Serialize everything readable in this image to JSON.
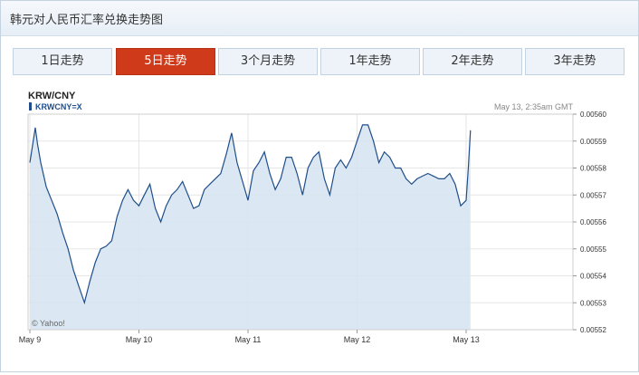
{
  "window": {
    "title": "韩元对人民币汇率兑换走势图"
  },
  "tabs": [
    {
      "label": "1日走势",
      "active": false
    },
    {
      "label": "5日走势",
      "active": true
    },
    {
      "label": "3个月走势",
      "active": false
    },
    {
      "label": "1年走势",
      "active": false
    },
    {
      "label": "2年走势",
      "active": false
    },
    {
      "label": "3年走势",
      "active": false
    }
  ],
  "colors": {
    "accent": "#cf3a1b",
    "series_line": "#1f4e8a",
    "area_fill": "#d5e4f1"
  },
  "chart_data": {
    "type": "area",
    "title": "KRW/CNY",
    "legend": "KRWCNY=X",
    "timestamp": "May 13, 2:35am GMT",
    "credit": "© Yahoo!",
    "x_tick_labels": [
      "May 9",
      "May 10",
      "May 11",
      "May 12",
      "May 13"
    ],
    "x_range": [
      0,
      4.05
    ],
    "ylim": [
      0.00552,
      0.0056
    ],
    "y_ticks": [
      "0.00552",
      "0.00553",
      "0.00554",
      "0.00555",
      "0.00556",
      "0.00557",
      "0.00558",
      "0.00559",
      "0.00560"
    ],
    "grid": true,
    "series": [
      {
        "name": "KRWCNY=X",
        "x": [
          0.0,
          0.05,
          0.07,
          0.1,
          0.15,
          0.2,
          0.25,
          0.3,
          0.35,
          0.4,
          0.45,
          0.5,
          0.55,
          0.6,
          0.65,
          0.7,
          0.75,
          0.8,
          0.85,
          0.9,
          0.95,
          1.0,
          1.05,
          1.1,
          1.15,
          1.2,
          1.25,
          1.3,
          1.35,
          1.4,
          1.45,
          1.5,
          1.55,
          1.6,
          1.65,
          1.7,
          1.75,
          1.8,
          1.85,
          1.9,
          1.95,
          2.0,
          2.05,
          2.1,
          2.15,
          2.2,
          2.25,
          2.3,
          2.35,
          2.4,
          2.45,
          2.5,
          2.55,
          2.6,
          2.65,
          2.7,
          2.75,
          2.8,
          2.85,
          2.9,
          2.95,
          3.0,
          3.05,
          3.1,
          3.15,
          3.2,
          3.25,
          3.3,
          3.35,
          3.4,
          3.45,
          3.5,
          3.55,
          3.6,
          3.65,
          3.7,
          3.75,
          3.8,
          3.85,
          3.9,
          3.95,
          4.0,
          4.02,
          4.04
        ],
        "values": [
          0.005582,
          0.005595,
          0.005589,
          0.005582,
          0.005573,
          0.005568,
          0.005563,
          0.005556,
          0.00555,
          0.005542,
          0.005536,
          0.00553,
          0.005538,
          0.005545,
          0.00555,
          0.005551,
          0.005553,
          0.005562,
          0.005568,
          0.005572,
          0.005568,
          0.005566,
          0.00557,
          0.005574,
          0.005565,
          0.00556,
          0.005566,
          0.00557,
          0.005572,
          0.005575,
          0.00557,
          0.005565,
          0.005566,
          0.005572,
          0.005574,
          0.005576,
          0.005578,
          0.005585,
          0.005593,
          0.005582,
          0.005575,
          0.005568,
          0.005579,
          0.005582,
          0.005586,
          0.005578,
          0.005572,
          0.005576,
          0.005584,
          0.005584,
          0.005578,
          0.00557,
          0.00558,
          0.005584,
          0.005586,
          0.005576,
          0.00557,
          0.00558,
          0.005583,
          0.00558,
          0.005584,
          0.00559,
          0.005596,
          0.005596,
          0.00559,
          0.005582,
          0.005586,
          0.005584,
          0.00558,
          0.00558,
          0.005576,
          0.005574,
          0.005576,
          0.005577,
          0.005578,
          0.005577,
          0.005576,
          0.005576,
          0.005578,
          0.005574,
          0.005566,
          0.005568,
          0.00558,
          0.005594
        ]
      }
    ]
  }
}
